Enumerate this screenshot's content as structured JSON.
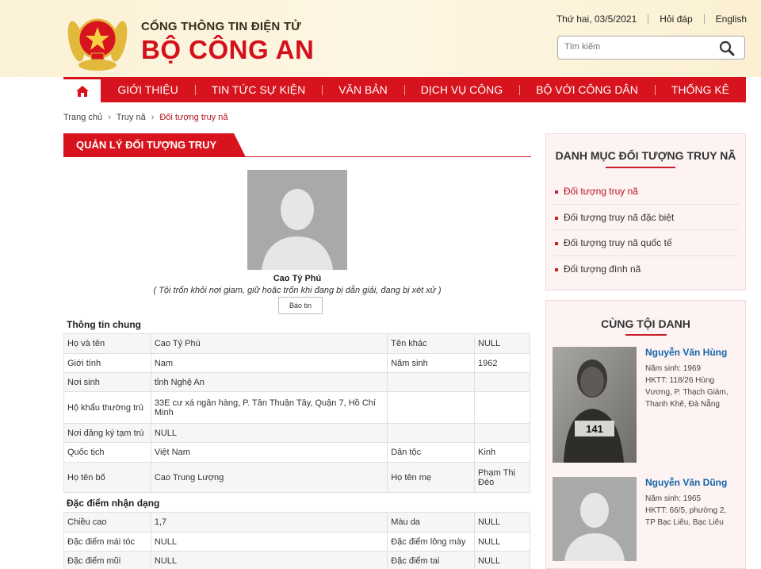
{
  "header": {
    "subtitle": "CỔNG THÔNG TIN ĐIỆN TỬ",
    "title": "BỘ CÔNG AN",
    "date": "Thứ hai, 03/5/2021",
    "faq": "Hỏi đáp",
    "lang": "English",
    "search_placeholder": "Tìm kiếm"
  },
  "nav": {
    "items": [
      "GIỚI THIỆU",
      "TIN TỨC SỰ KIỆN",
      "VĂN BẢN",
      "DỊCH VỤ CÔNG",
      "BỘ VỚI CÔNG DÂN",
      "THỐNG KÊ"
    ]
  },
  "breadcrumb": [
    "Trang chủ",
    "Truy nã",
    "Đối tượng truy nã"
  ],
  "section_title": "QUẢN LÝ ĐỐI TƯỢNG TRUY NÃ",
  "profile": {
    "name": "Cao Tỷ Phú",
    "note": "( Tội trốn khỏi nơi giam, giữ hoặc trốn khi đang bị dẫn giải, đang bị xét xử )",
    "report_label": "Báo tin"
  },
  "general": {
    "title": "Thông tin chung",
    "rows": [
      [
        "Họ và tên",
        "Cao Tỷ Phú",
        "Tên khác",
        "NULL"
      ],
      [
        "Giới tính",
        "Nam",
        "Năm sinh",
        "1962"
      ],
      [
        "Nơi sinh",
        "tỉnh Nghệ An",
        "",
        ""
      ],
      [
        "Hộ khẩu thường trú",
        "33E cư xá ngân hàng, P. Tân Thuận Tây, Quận 7, Hồ Chí Minh",
        "",
        ""
      ],
      [
        "Nơi đăng ký tạm trú",
        "NULL",
        "",
        ""
      ],
      [
        "Quốc tịch",
        "Việt Nam",
        "Dân tộc",
        "Kinh"
      ],
      [
        "Họ tên bố",
        "Cao Trung Lượng",
        "Họ tên mẹ",
        "Phạm Thị Đèo"
      ]
    ]
  },
  "features": {
    "title": "Đặc điểm nhận dạng",
    "rows": [
      [
        "Chiều cao",
        "1,7",
        "Màu da",
        "NULL"
      ],
      [
        "Đặc điểm mái tóc",
        "NULL",
        "Đặc điểm lông mày",
        "NULL"
      ],
      [
        "Đặc điểm mũi",
        "NULL",
        "Đặc điểm tai",
        "NULL"
      ]
    ]
  },
  "sidebar": {
    "categories_title": "DANH MỤC ĐỐI TƯỢNG TRUY NÃ",
    "categories": [
      "Đối tượng truy nã",
      "Đối tượng truy nã đặc biệt",
      "Đối tượng truy nã quốc tế",
      "Đối tượng đình nã"
    ],
    "related_title": "CÙNG TỘI DANH",
    "related": [
      {
        "name": "Nguyễn Văn Hùng",
        "birth": "Năm sinh: 1969",
        "address": "HKTT: 118/26 Hùng Vương, P. Thạch Giám, Thanh Khê, Đà Nẵng",
        "placard": "141"
      },
      {
        "name": "Nguyễn Văn Dũng",
        "birth": "Năm sinh: 1965",
        "address": "HKTT: 66/5, phường 2, TP Bạc Liêu, Bạc Liêu"
      }
    ]
  }
}
